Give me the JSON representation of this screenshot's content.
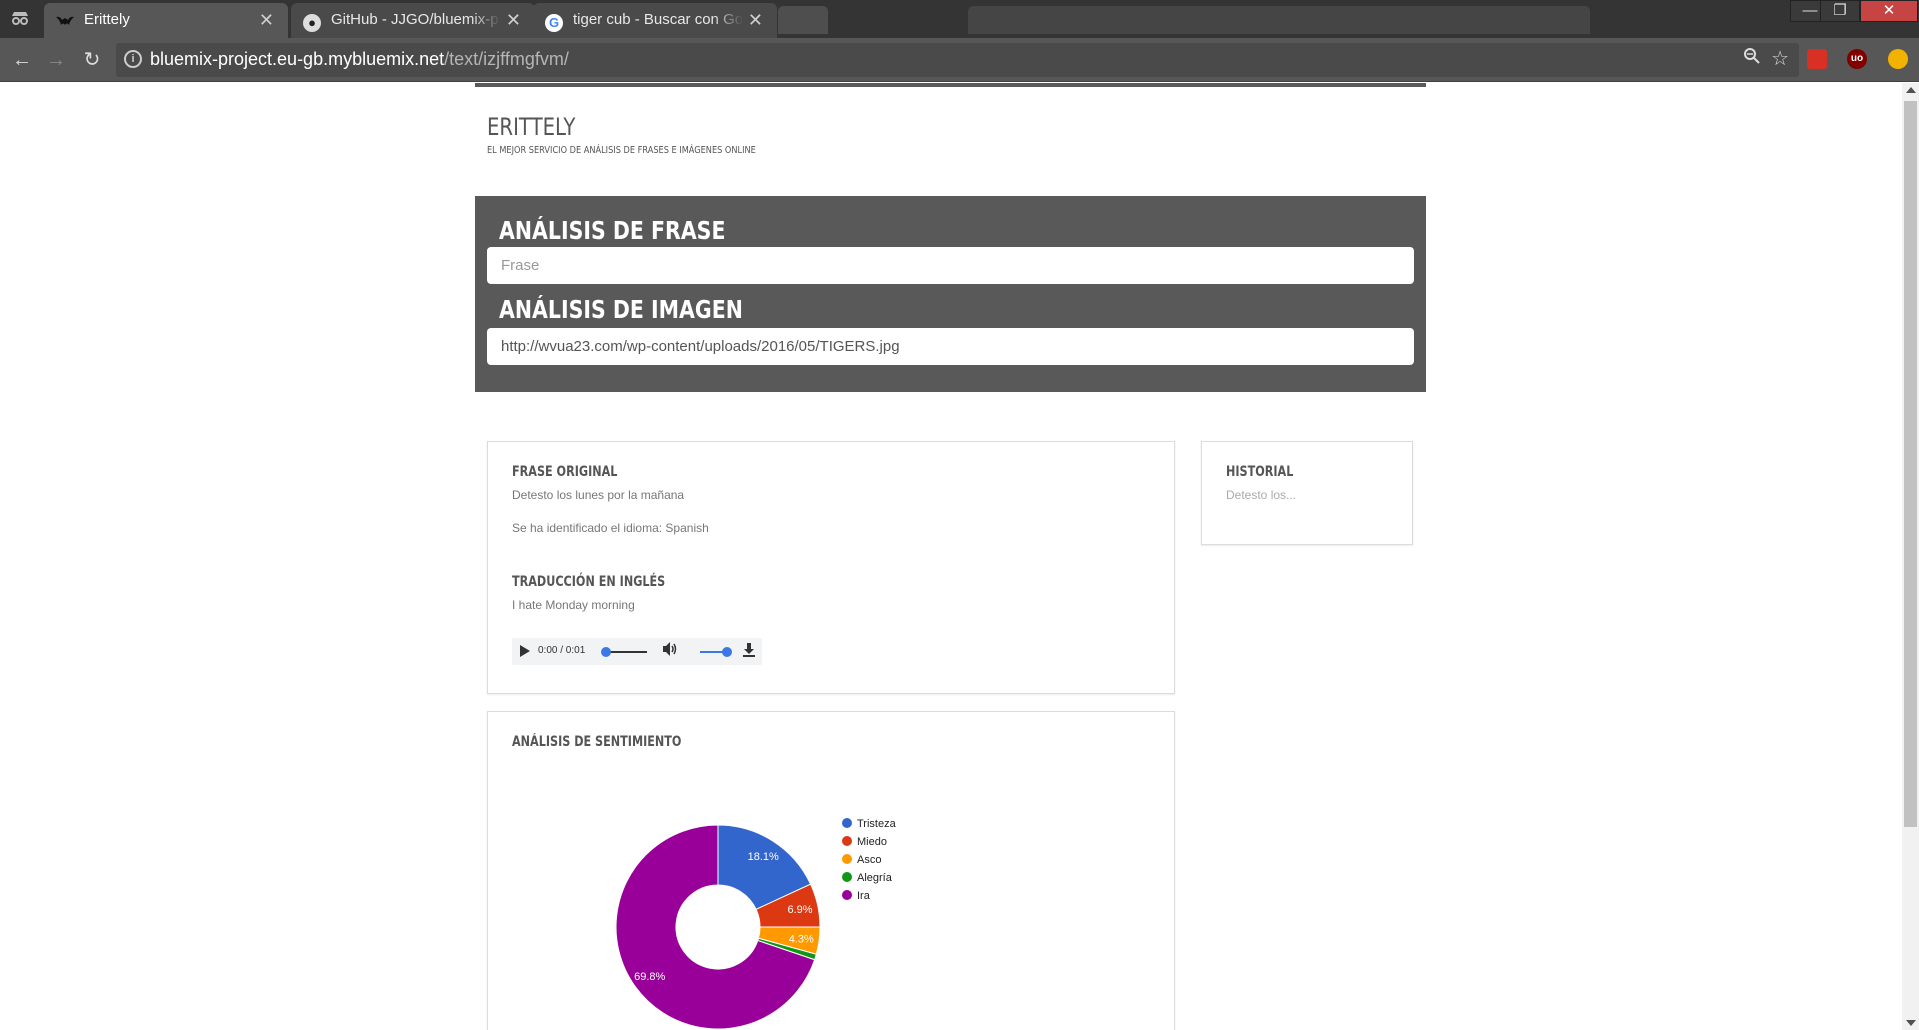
{
  "browser": {
    "tabs": [
      {
        "title": "Erittely",
        "favicon": "bat-icon",
        "active": true
      },
      {
        "title": "GitHub - JJGO/bluemix-p",
        "favicon": "github-icon",
        "active": false
      },
      {
        "title": "tiger cub - Buscar con Go",
        "favicon": "google-icon",
        "active": false
      }
    ],
    "url_host": "bluemix-project.eu-gb.mybluemix.net",
    "url_path": "/text/izjffmgfvm/",
    "extensions": [
      {
        "name": "bookmark-extension-icon",
        "color": "#d93025",
        "label": ""
      },
      {
        "name": "ublock-icon",
        "color": "#800000",
        "label": "uo"
      },
      {
        "name": "extension-yellow-icon",
        "color": "#f2b200",
        "label": ""
      }
    ]
  },
  "site": {
    "title": "ERITTELY",
    "subtitle": "EL MEJOR SERVICIO DE ANÁLISIS DE FRASES E IMÁGENES ONLINE"
  },
  "hero": {
    "phrase_heading": "ANÁLISIS DE FRASE",
    "phrase_placeholder": "Frase",
    "phrase_value": "",
    "image_heading": "ANÁLISIS DE IMAGEN",
    "image_value": "http://wvua23.com/wp-content/uploads/2016/05/TIGERS.jpg"
  },
  "original": {
    "heading": "FRASE ORIGINAL",
    "text": "Detesto los lunes por la mañana",
    "language": "Se ha identificado el idioma: Spanish",
    "translation_heading": "TRADUCCIÓN EN INGLÉS",
    "translation": "I hate Monday morning",
    "audio_time": "0:00 / 0:01",
    "audio_progress": 0.0,
    "audio_volume": 1.0
  },
  "history": {
    "heading": "HISTORIAL",
    "items": [
      "Detesto los..."
    ]
  },
  "sentiment": {
    "heading": "ANÁLISIS DE SENTIMIENTO"
  },
  "chart_data": {
    "type": "pie",
    "donut": true,
    "legend_position": "right",
    "series": [
      {
        "name": "Tristeza",
        "value": 18.1,
        "label": "18.1%",
        "color": "#3366cc"
      },
      {
        "name": "Miedo",
        "value": 6.9,
        "label": "6.9%",
        "color": "#dc3912"
      },
      {
        "name": "Asco",
        "value": 4.3,
        "label": "4.3%",
        "color": "#ff9900"
      },
      {
        "name": "Alegría",
        "value": 0.9,
        "label": "",
        "color": "#109618"
      },
      {
        "name": "Ira",
        "value": 69.8,
        "label": "69.8%",
        "color": "#990099"
      }
    ]
  }
}
